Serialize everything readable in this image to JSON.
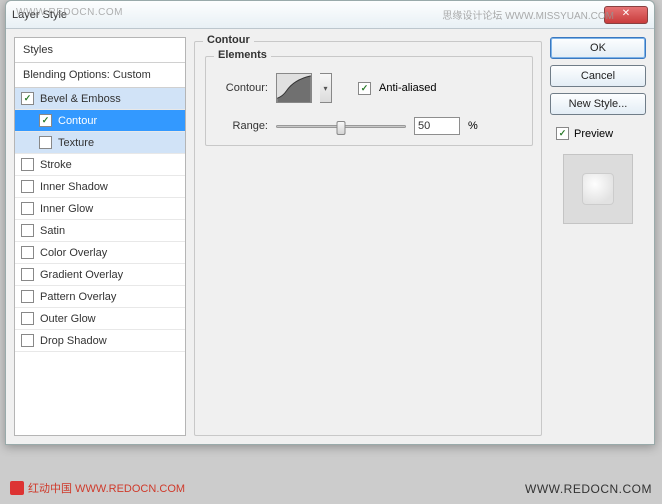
{
  "window": {
    "title": "Layer Style",
    "watermark_left": "WWW.REDOCN.COM",
    "watermark_right": "思缘设计论坛  WWW.MISSYUAN.COM"
  },
  "sidebar": {
    "header": "Styles",
    "blending": "Blending Options: Custom",
    "items": [
      {
        "label": "Bevel & Emboss",
        "checked": true,
        "selected": true,
        "indented": false
      },
      {
        "label": "Contour",
        "checked": true,
        "selected": false,
        "highlighted": true,
        "indented": true
      },
      {
        "label": "Texture",
        "checked": false,
        "selected": true,
        "indented": true
      },
      {
        "label": "Stroke",
        "checked": false,
        "indented": false
      },
      {
        "label": "Inner Shadow",
        "checked": false,
        "indented": false
      },
      {
        "label": "Inner Glow",
        "checked": false,
        "indented": false
      },
      {
        "label": "Satin",
        "checked": false,
        "indented": false
      },
      {
        "label": "Color Overlay",
        "checked": false,
        "indented": false
      },
      {
        "label": "Gradient Overlay",
        "checked": false,
        "indented": false
      },
      {
        "label": "Pattern Overlay",
        "checked": false,
        "indented": false
      },
      {
        "label": "Outer Glow",
        "checked": false,
        "indented": false
      },
      {
        "label": "Drop Shadow",
        "checked": false,
        "indented": false
      }
    ]
  },
  "main": {
    "group_title": "Contour",
    "elements_title": "Elements",
    "contour_label": "Contour:",
    "antialiased_label": "Anti-aliased",
    "antialiased_checked": true,
    "range_label": "Range:",
    "range_value": "50",
    "range_unit": "%"
  },
  "buttons": {
    "ok": "OK",
    "cancel": "Cancel",
    "new_style": "New Style...",
    "preview_label": "Preview",
    "preview_checked": true
  },
  "footer": {
    "left": "红动中国  WWW.REDOCN.COM",
    "right": "WWW.REDOCN.COM"
  }
}
